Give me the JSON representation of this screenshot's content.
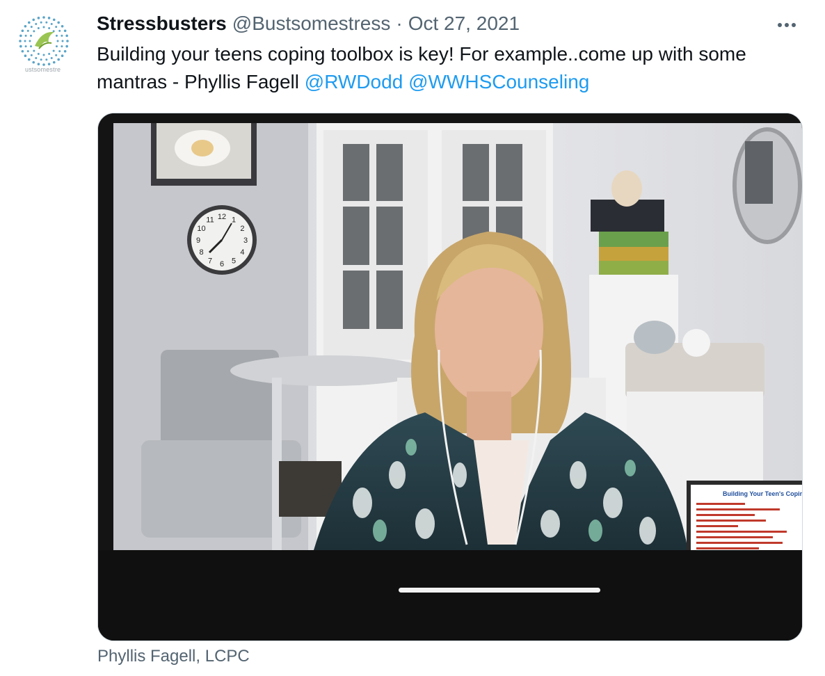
{
  "avatar": {
    "caption": "ustsomestre"
  },
  "tweet": {
    "display_name": "Stressbusters",
    "handle": "@Bustsomestress",
    "separator": "·",
    "date": "Oct 27, 2021",
    "text": "Building your teens coping toolbox is key! For example..come up with some mantras - Phyllis Fagell",
    "mentions": [
      "@RWDodd",
      "@WWHSCounseling"
    ]
  },
  "media": {
    "slide_title": "Building Your Teen's Coping",
    "clock_numbers": [
      "12",
      "1",
      "2",
      "3",
      "4",
      "5",
      "6",
      "7",
      "8",
      "9",
      "10",
      "11"
    ]
  },
  "media_caption": "Phyllis Fagell, LCPC",
  "icons": {
    "more": "more-horizontal-icon"
  },
  "colors": {
    "link": "#1d9bf0",
    "secondary_text": "#536471",
    "primary_text": "#0f1419"
  }
}
